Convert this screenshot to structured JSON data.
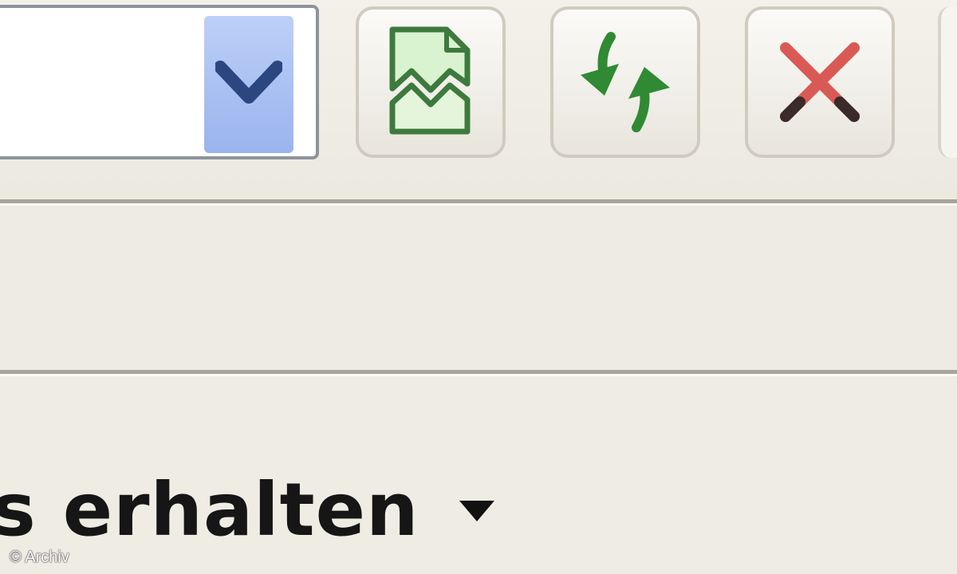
{
  "toolbar": {
    "address_value": "",
    "dropdown_icon": "chevron-down-icon",
    "buttons": [
      {
        "icon": "broken-page-icon",
        "color": "#3d7a3d"
      },
      {
        "icon": "refresh-arrows-icon",
        "color": "#2f8a33"
      },
      {
        "icon": "close-x-icon",
        "color": "#d95a55"
      }
    ]
  },
  "menu": {
    "label": "s erhalten",
    "arrow_icon": "dropdown-triangle-icon"
  },
  "watermark": {
    "text": "© Archiv"
  },
  "colors": {
    "dropdown_bg": "#a9c0f2",
    "chevron": "#2c4680",
    "page_background": "#efece3",
    "close_red": "#d95a55",
    "refresh_green": "#2f8a33"
  }
}
